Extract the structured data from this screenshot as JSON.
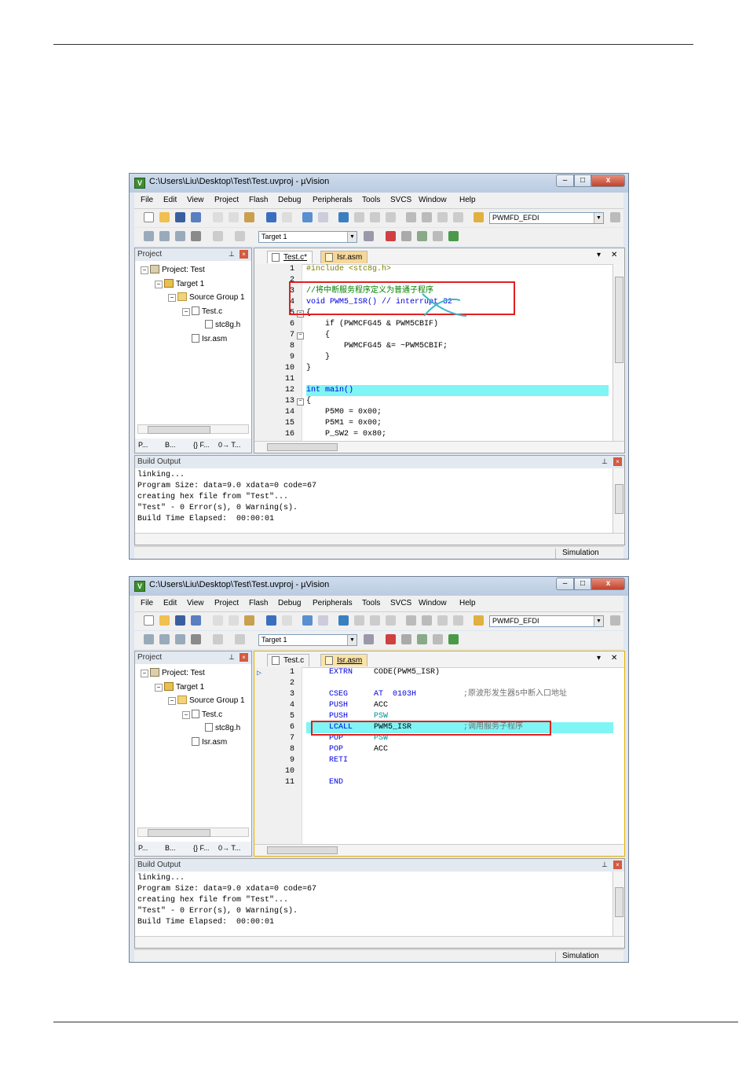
{
  "windows": [
    {
      "title": "C:\\Users\\Liu\\Desktop\\Test\\Test.uvproj - µVision",
      "menu": [
        "File",
        "Edit",
        "View",
        "Project",
        "Flash",
        "Debug",
        "Peripherals",
        "Tools",
        "SVCS",
        "Window",
        "Help"
      ],
      "toolbar": {
        "device_select": "PWMFD_EFDI",
        "target_select": "Target 1"
      },
      "project_pane": {
        "title": "Project",
        "tree": [
          "Project: Test",
          "Target 1",
          "Source Group 1",
          "Test.c",
          "stc8g.h",
          "Isr.asm"
        ],
        "bottom_tabs": [
          "P...",
          "B...",
          "{} F...",
          "0→ T..."
        ]
      },
      "editor": {
        "tabs": [
          {
            "label": "Test.c*",
            "active": true
          },
          {
            "label": "Isr.asm",
            "active": false
          }
        ],
        "lines": [
          {
            "n": "1",
            "t": "#include <stc8g.h>"
          },
          {
            "n": "2",
            "t": ""
          },
          {
            "n": "3",
            "t": "//将中断服务程序定义为普通子程序"
          },
          {
            "n": "4",
            "t": "void PWM5_ISR() // interrupt 32"
          },
          {
            "n": "5",
            "t": "{"
          },
          {
            "n": "6",
            "t": "    if (PWMCFG45 & PWM5CBIF)"
          },
          {
            "n": "7",
            "t": "    {"
          },
          {
            "n": "8",
            "t": "        PWMCFG45 &= ~PWM5CBIF;"
          },
          {
            "n": "9",
            "t": "    }"
          },
          {
            "n": "10",
            "t": "}"
          },
          {
            "n": "11",
            "t": ""
          },
          {
            "n": "12",
            "t": "int main()"
          },
          {
            "n": "13",
            "t": "{"
          },
          {
            "n": "14",
            "t": "    P5M0 = 0x00;"
          },
          {
            "n": "15",
            "t": "    P5M1 = 0x00;"
          },
          {
            "n": "16",
            "t": "    P_SW2 = 0x80;"
          }
        ]
      },
      "build_output": {
        "title": "Build Output",
        "lines": [
          "linking...",
          "Program Size: data=9.0 xdata=0 code=67",
          "creating hex file from \"Test\"...",
          "\"Test\" - 0 Error(s), 0 Warning(s).",
          "Build Time Elapsed:  00:00:01"
        ]
      },
      "status": "Simulation"
    },
    {
      "title": "C:\\Users\\Liu\\Desktop\\Test\\Test.uvproj - µVision",
      "menu": [
        "File",
        "Edit",
        "View",
        "Project",
        "Flash",
        "Debug",
        "Peripherals",
        "Tools",
        "SVCS",
        "Window",
        "Help"
      ],
      "toolbar": {
        "device_select": "PWMFD_EFDI",
        "target_select": "Target 1"
      },
      "project_pane": {
        "title": "Project",
        "tree": [
          "Project: Test",
          "Target 1",
          "Source Group 1",
          "Test.c",
          "stc8g.h",
          "Isr.asm"
        ],
        "bottom_tabs": [
          "P...",
          "B...",
          "{} F...",
          "0→ T..."
        ]
      },
      "editor": {
        "tabs": [
          {
            "label": "Test.c",
            "active": false
          },
          {
            "label": "Isr.asm",
            "active": true
          }
        ],
        "lines": [
          {
            "n": "1",
            "op": "EXTRN",
            "arg": "CODE(PWM5_ISR)",
            "cm": ""
          },
          {
            "n": "2",
            "op": "",
            "arg": "",
            "cm": ""
          },
          {
            "n": "3",
            "op": "CSEG",
            "arg": "AT  0103H",
            "cm": ";原波形发生器5中断入口地址"
          },
          {
            "n": "4",
            "op": "PUSH",
            "arg": "ACC",
            "cm": ""
          },
          {
            "n": "5",
            "op": "PUSH",
            "arg": "PSW",
            "cm": ""
          },
          {
            "n": "6",
            "op": "LCALL",
            "arg": "PWM5_ISR",
            "cm": ";调用服务子程序"
          },
          {
            "n": "7",
            "op": "POP",
            "arg": "PSW",
            "cm": ""
          },
          {
            "n": "8",
            "op": "POP",
            "arg": "ACC",
            "cm": ""
          },
          {
            "n": "9",
            "op": "RETI",
            "arg": "",
            "cm": ""
          },
          {
            "n": "10",
            "op": "",
            "arg": "",
            "cm": ""
          },
          {
            "n": "11",
            "op": "END",
            "arg": "",
            "cm": ""
          }
        ]
      },
      "build_output": {
        "title": "Build Output",
        "lines": [
          "linking...",
          "Program Size: data=9.0 xdata=0 code=67",
          "creating hex file from \"Test\"...",
          "\"Test\" - 0 Error(s), 0 Warning(s).",
          "Build Time Elapsed:  00:00:01"
        ]
      },
      "status": "Simulation"
    }
  ]
}
